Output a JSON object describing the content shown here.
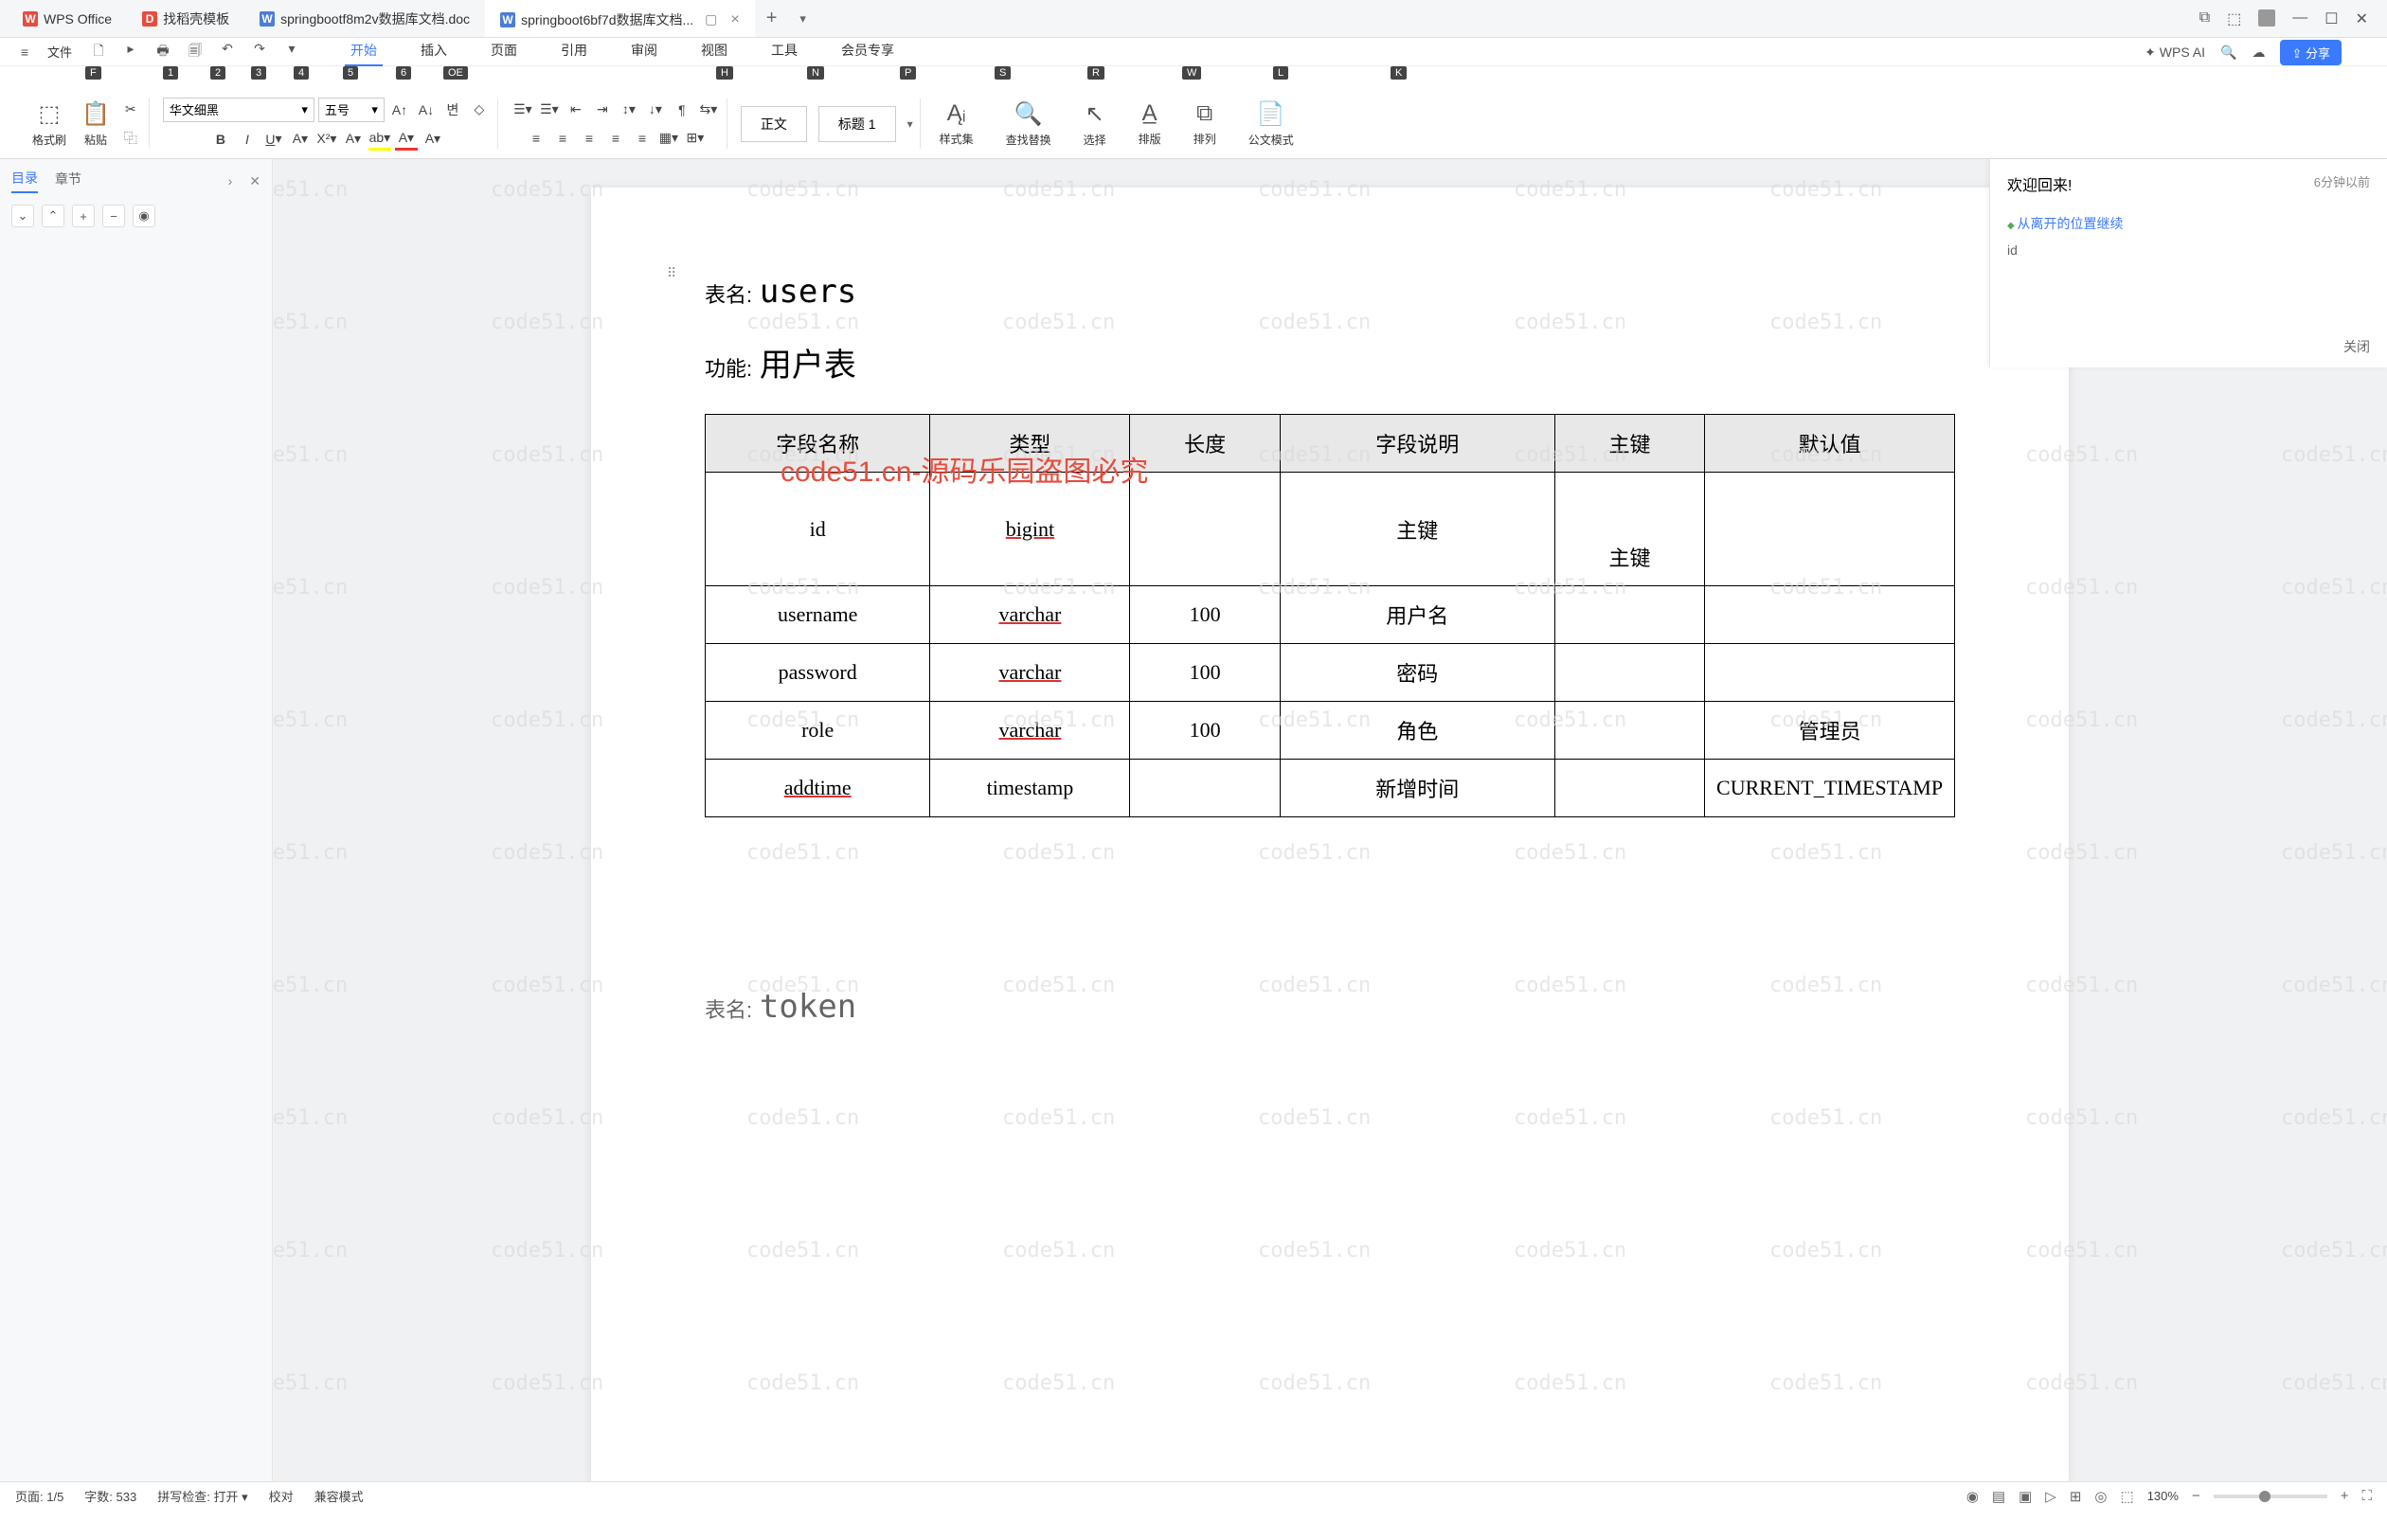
{
  "tabs": {
    "app": "WPS Office",
    "t1": "找稻壳模板",
    "t2": "springbootf8m2v数据库文档.doc",
    "t3": "springboot6bf7d数据库文档..."
  },
  "file_menu": "文件",
  "key_hints": {
    "f": "F",
    "n1": "1",
    "n2": "2",
    "n3": "3",
    "n4": "4",
    "n5": "5",
    "n6": "6",
    "oe": "OE"
  },
  "ribbon_tabs": {
    "start": "开始",
    "insert": "插入",
    "page": "页面",
    "ref": "引用",
    "review": "审阅",
    "view": "视图",
    "tool": "工具",
    "member": "会员专享",
    "ai": "WPS AI"
  },
  "ribbon_keys": {
    "h": "H",
    "n": "N",
    "p": "P",
    "s": "S",
    "r": "R",
    "w": "W",
    "l": "L",
    "k": "K"
  },
  "share_btn": "分享",
  "ribbon": {
    "format_painter": "格式刷",
    "paste": "粘贴",
    "font": "华文细黑",
    "size": "五号",
    "style_text": "正文",
    "style_h1": "标题 1",
    "style_set": "样式集",
    "find_replace": "查找替换",
    "select": "选择",
    "layout": "排版",
    "arrange": "排列",
    "paper_mode": "公文模式"
  },
  "side": {
    "tab1": "目录",
    "tab2": "章节",
    "close": "✕"
  },
  "welcome": {
    "title": "欢迎回来!",
    "time": "6分钟以前",
    "link": "从离开的位置继续",
    "id": "id",
    "close": "关闭"
  },
  "doc": {
    "table_label": "表名:",
    "table_name": "users",
    "func_label": "功能:",
    "func_name": "用户表",
    "next_label": "表名:",
    "next_name": "token",
    "headers": {
      "field": "字段名称",
      "type": "类型",
      "len": "长度",
      "desc": "字段说明",
      "pk": "主键",
      "default": "默认值"
    },
    "rows": [
      {
        "field": "id",
        "type": "bigint",
        "len": "",
        "desc": "主键",
        "pk": "主键",
        "default": ""
      },
      {
        "field": "username",
        "type": "varchar",
        "len": "100",
        "desc": "用户名",
        "pk": "",
        "default": ""
      },
      {
        "field": "password",
        "type": "varchar",
        "len": "100",
        "desc": "密码",
        "pk": "",
        "default": ""
      },
      {
        "field": "role",
        "type": "varchar",
        "len": "100",
        "desc": "角色",
        "pk": "",
        "default": "管理员"
      },
      {
        "field": "addtime",
        "type": "timestamp",
        "len": "",
        "desc": "新增时间",
        "pk": "",
        "default": "CURRENT_TIMESTAMP"
      }
    ]
  },
  "watermark": "code51.cn",
  "watermark_red": "code51.cn-源码乐园盗图必究",
  "status": {
    "page": "页面: 1/5",
    "words": "字数: 533",
    "spell": "拼写检查: 打开",
    "proof": "校对",
    "compat": "兼容模式",
    "zoom": "130%"
  }
}
